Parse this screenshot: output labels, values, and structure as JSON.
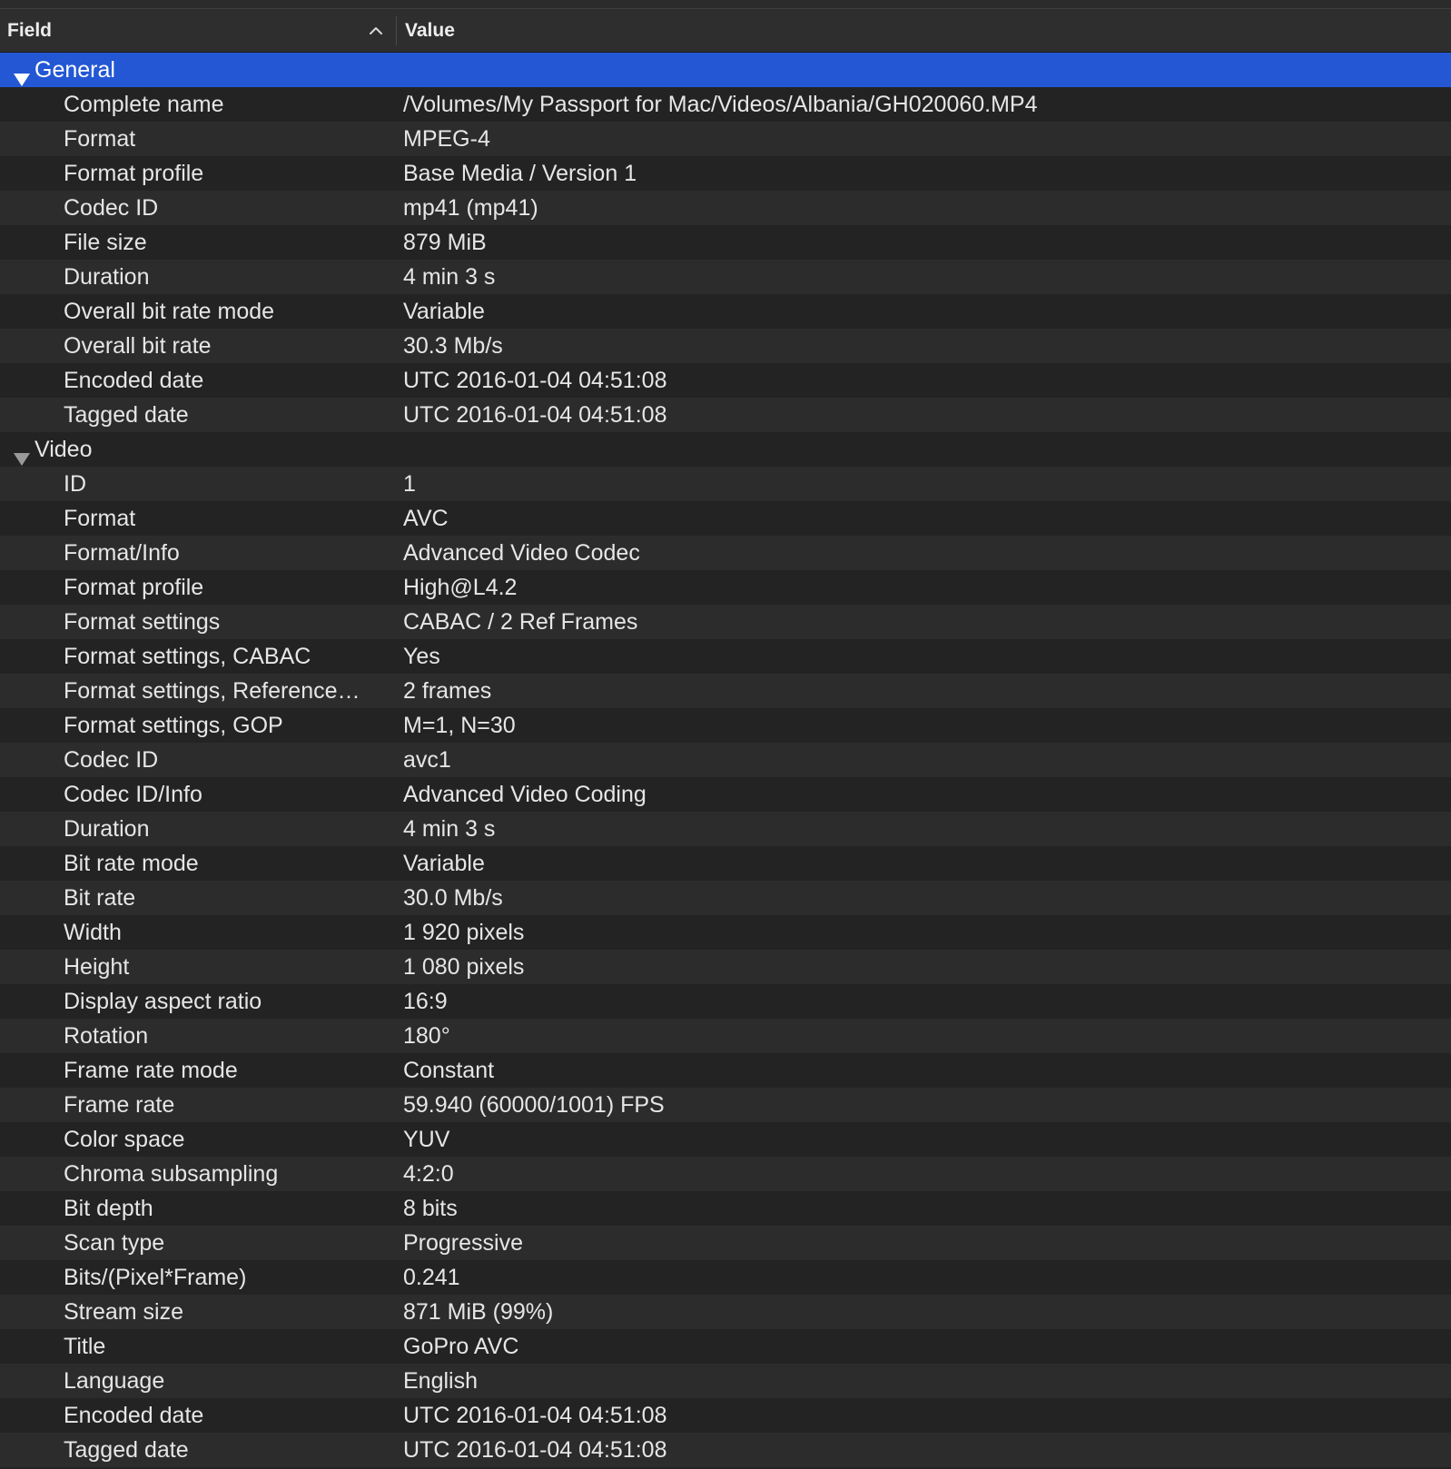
{
  "columns": {
    "field": "Field",
    "value": "Value",
    "sort_icon": "chevron-up-icon"
  },
  "general": {
    "label": "General",
    "rows": [
      {
        "field": "Complete name",
        "value": "/Volumes/My Passport for Mac/Videos/Albania/GH020060.MP4"
      },
      {
        "field": "Format",
        "value": "MPEG-4"
      },
      {
        "field": "Format profile",
        "value": "Base Media / Version 1"
      },
      {
        "field": "Codec ID",
        "value": "mp41 (mp41)"
      },
      {
        "field": "File size",
        "value": "879 MiB"
      },
      {
        "field": "Duration",
        "value": "4 min 3 s"
      },
      {
        "field": "Overall bit rate mode",
        "value": "Variable"
      },
      {
        "field": "Overall bit rate",
        "value": "30.3 Mb/s"
      },
      {
        "field": "Encoded date",
        "value": "UTC 2016-01-04 04:51:08"
      },
      {
        "field": "Tagged date",
        "value": "UTC 2016-01-04 04:51:08"
      }
    ]
  },
  "video": {
    "label": "Video",
    "rows": [
      {
        "field": "ID",
        "value": "1"
      },
      {
        "field": "Format",
        "value": "AVC"
      },
      {
        "field": "Format/Info",
        "value": "Advanced Video Codec"
      },
      {
        "field": "Format profile",
        "value": "High@L4.2"
      },
      {
        "field": "Format settings",
        "value": "CABAC / 2 Ref Frames"
      },
      {
        "field": "Format settings, CABAC",
        "value": "Yes"
      },
      {
        "field": "Format settings, Reference…",
        "value": "2 frames"
      },
      {
        "field": "Format settings, GOP",
        "value": "M=1, N=30"
      },
      {
        "field": "Codec ID",
        "value": "avc1"
      },
      {
        "field": "Codec ID/Info",
        "value": "Advanced Video Coding"
      },
      {
        "field": "Duration",
        "value": "4 min 3 s"
      },
      {
        "field": "Bit rate mode",
        "value": "Variable"
      },
      {
        "field": "Bit rate",
        "value": "30.0 Mb/s"
      },
      {
        "field": "Width",
        "value": "1 920 pixels"
      },
      {
        "field": "Height",
        "value": "1 080 pixels"
      },
      {
        "field": "Display aspect ratio",
        "value": "16:9"
      },
      {
        "field": "Rotation",
        "value": "180°"
      },
      {
        "field": "Frame rate mode",
        "value": "Constant"
      },
      {
        "field": "Frame rate",
        "value": "59.940 (60000/1001) FPS"
      },
      {
        "field": "Color space",
        "value": "YUV"
      },
      {
        "field": "Chroma subsampling",
        "value": "4:2:0"
      },
      {
        "field": "Bit depth",
        "value": "8 bits"
      },
      {
        "field": "Scan type",
        "value": "Progressive"
      },
      {
        "field": "Bits/(Pixel*Frame)",
        "value": "0.241"
      },
      {
        "field": "Stream size",
        "value": "871 MiB (99%)"
      },
      {
        "field": "Title",
        "value": "GoPro AVC"
      },
      {
        "field": "Language",
        "value": "English"
      },
      {
        "field": "Encoded date",
        "value": "UTC 2016-01-04 04:51:08"
      },
      {
        "field": "Tagged date",
        "value": "UTC 2016-01-04 04:51:08"
      }
    ]
  },
  "colors": {
    "selection": "#2357d4",
    "row_odd": "#2c2c2c",
    "row_even": "#232323",
    "text": "#e6e6e6"
  }
}
